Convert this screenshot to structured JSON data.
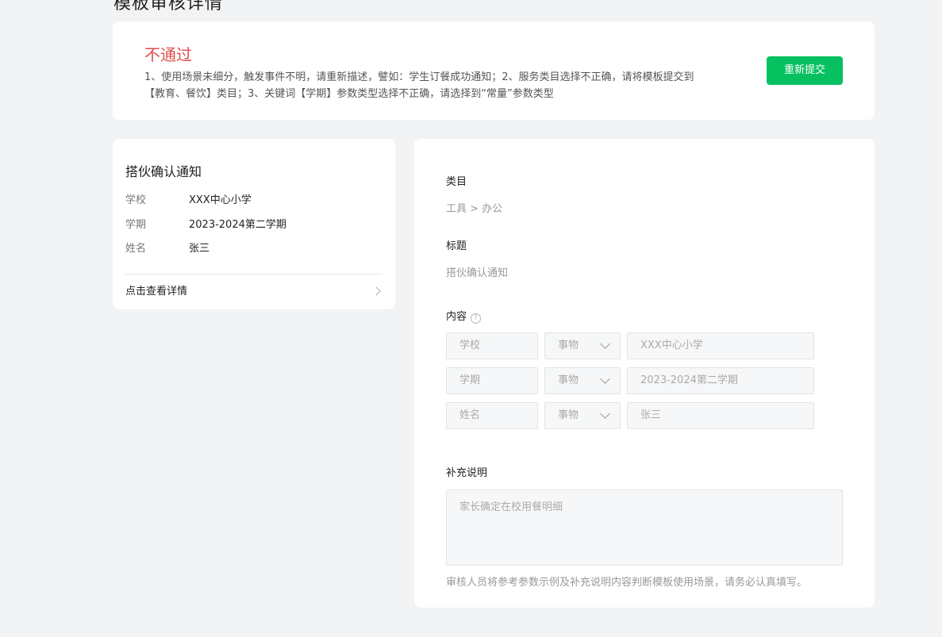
{
  "page": {
    "title": "模板审核详情"
  },
  "review": {
    "status": "不通过",
    "reason_line1": "1、使用场景未细分，触发事件不明，请重新描述，譬如：学生订餐成功通知；2、服务类目选择不正确，请将模板提交到",
    "reason_line2": "【教育、餐饮】类目；3、关键词【学期】参数类型选择不正确，请选择到“常量”参数类型",
    "resubmit_label": "重新提交",
    "accent_color": "#07c160",
    "status_color": "#e24c4c"
  },
  "preview": {
    "title": "搭伙确认通知",
    "rows": [
      {
        "key": "学校",
        "value": "XXX中心小学"
      },
      {
        "key": "学期",
        "value": "2023-2024第二学期"
      },
      {
        "key": "姓名",
        "value": "张三"
      }
    ],
    "detail_link": "点击查看详情"
  },
  "form": {
    "category_label": "类目",
    "category_value": "工具 > 办公",
    "title_label": "标题",
    "title_value": "搭伙确认通知",
    "content_label": "内容",
    "help_icon": "?",
    "params": [
      {
        "name": "学校",
        "type": "事物",
        "example": "XXX中心小学"
      },
      {
        "name": "学期",
        "type": "事物",
        "example": "2023-2024第二学期"
      },
      {
        "name": "姓名",
        "type": "事物",
        "example": "张三"
      }
    ],
    "remark_label": "补充说明",
    "remark_value": "家长确定在校用餐明细",
    "remark_hint": "审核人员将参考参数示例及补充说明内容判断模板使用场景，请务必认真填写。"
  }
}
